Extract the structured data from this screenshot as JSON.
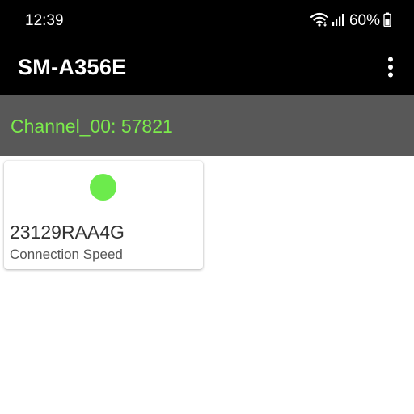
{
  "status_bar": {
    "time": "12:39",
    "battery_percent": "60%",
    "icons": [
      "wifi-icon",
      "signal-icon",
      "battery-icon"
    ]
  },
  "app_bar": {
    "title": "SM-A356E",
    "menu_icon": "more-vert-icon"
  },
  "channel": {
    "label": "Channel_00: 57821",
    "text_color": "#7CEB4C",
    "background": "#585858"
  },
  "devices": [
    {
      "id": "23129RAA4G",
      "subtitle": "Connection Speed",
      "status_color": "#6CEB4C"
    }
  ]
}
